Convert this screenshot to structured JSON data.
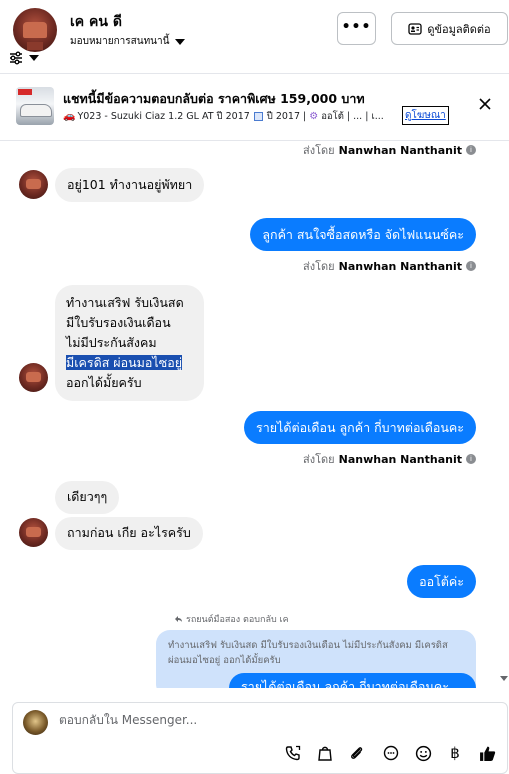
{
  "header": {
    "contact_name": "เค คน ดี",
    "assign_label": "มอบหมายการสนทนานี้",
    "more_label": "•••",
    "view_contact_label": "ดูข้อมูลติดต่อ"
  },
  "ad": {
    "title": "แชทนี้มีข้อความตอบกลับต่อ ราคาพิเศษ 159,000 บาท",
    "subtitle": "Y023 - Suzuki Ciaz 1.2 GL AT ปี 2017",
    "subtitle_year": "ปี 2017 |",
    "subtitle_trans": "ออโต้ | ... | เ...",
    "link_label": "ดูโฆษณา"
  },
  "messages": {
    "sent_prefix": "ส่งโดย",
    "sender_name": "Nanwhan Nanthanit",
    "m1": "อยู่101 ทำงานอยู่พัทยา",
    "m2": "ลูกค้า สนใจซื้อสดหรือ จัดไฟแนนซ์คะ",
    "m3_line1": "ทำงานเสริฟ รับเงินสด",
    "m3_line2": "มีใบรับรองเงินเดือน",
    "m3_line3": "ไม่มีประกันสังคม",
    "m3_line4": "มีเครดิส ผ่อนมอไซอยู่",
    "m3_line5": "ออกได้มั้ยครับ",
    "m4": "รายได้ต่อเดือน ลูกค้า กี่บาทต่อเดือนคะ",
    "m5": "เดียวๆๆ",
    "m6": "ถามก่อน เกีย อะไรครับ",
    "m7": "ออโต้ค่ะ",
    "reply_note": "รถยนต์มือสอง ตอบกลับ เค",
    "reply_preview": "ทำงานเสริฟ รับเงินสด มีใบรับรองเงินเดือน ไม่มีประกันสังคม มีเครดิส ผ่อนมอไซอยู่ ออกได้มั้ยครับ",
    "reply_below": "รายได้ต่อเดือน ลูกค้า กี่บาทต่อเดือนคะ"
  },
  "composer": {
    "placeholder": "ตอบกลับใน Messenger..."
  },
  "colors": {
    "outgoing": "#0a7cff",
    "incoming": "#f0f0f0",
    "highlight": "#1a4fb0"
  },
  "icons": [
    "filter-icon",
    "more-icon",
    "contact-card-icon",
    "car-icon",
    "calendar-icon",
    "gear-icon",
    "close-icon",
    "info-icon",
    "reply-arrow-icon",
    "call-icon",
    "bag-icon",
    "attachment-icon",
    "chat-icon",
    "emoji-icon",
    "baht-icon",
    "like-icon"
  ]
}
